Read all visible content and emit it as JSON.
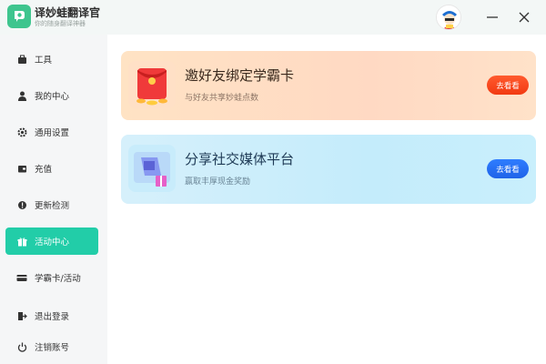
{
  "app": {
    "title": "译妙蛙翻译官",
    "subtitle": "你的随身翻译神器"
  },
  "window": {
    "minimize_icon": "minimize-icon",
    "close_icon": "close-icon"
  },
  "sidebar": {
    "items": [
      {
        "label": "工具",
        "icon": "briefcase-icon",
        "active": false
      },
      {
        "label": "我的中心",
        "icon": "user-icon",
        "active": false
      },
      {
        "label": "通用设置",
        "icon": "gear-icon",
        "active": false
      },
      {
        "label": "充值",
        "icon": "wallet-icon",
        "active": false
      },
      {
        "label": "更新检测",
        "icon": "update-icon",
        "active": false
      },
      {
        "label": "活动中心",
        "icon": "gift-icon",
        "active": true
      },
      {
        "label": "学霸卡/活动",
        "icon": "card-icon",
        "active": false
      },
      {
        "label": "退出登录",
        "icon": "logout-icon",
        "active": false
      },
      {
        "label": "注销账号",
        "icon": "power-icon",
        "active": false
      }
    ]
  },
  "cards": [
    {
      "title": "邀好友绑定学霸卡",
      "desc": "与好友共享妙蛙点数",
      "button": "去看看",
      "icon": "red-envelope-icon"
    },
    {
      "title": "分享社交媒体平台",
      "desc": "赢取丰厚现金奖励",
      "button": "去看看",
      "icon": "share-gift-icon"
    }
  ],
  "colors": {
    "accent": "#22cda8",
    "invite_button": "#f23a12",
    "share_button": "#1f63e8"
  }
}
